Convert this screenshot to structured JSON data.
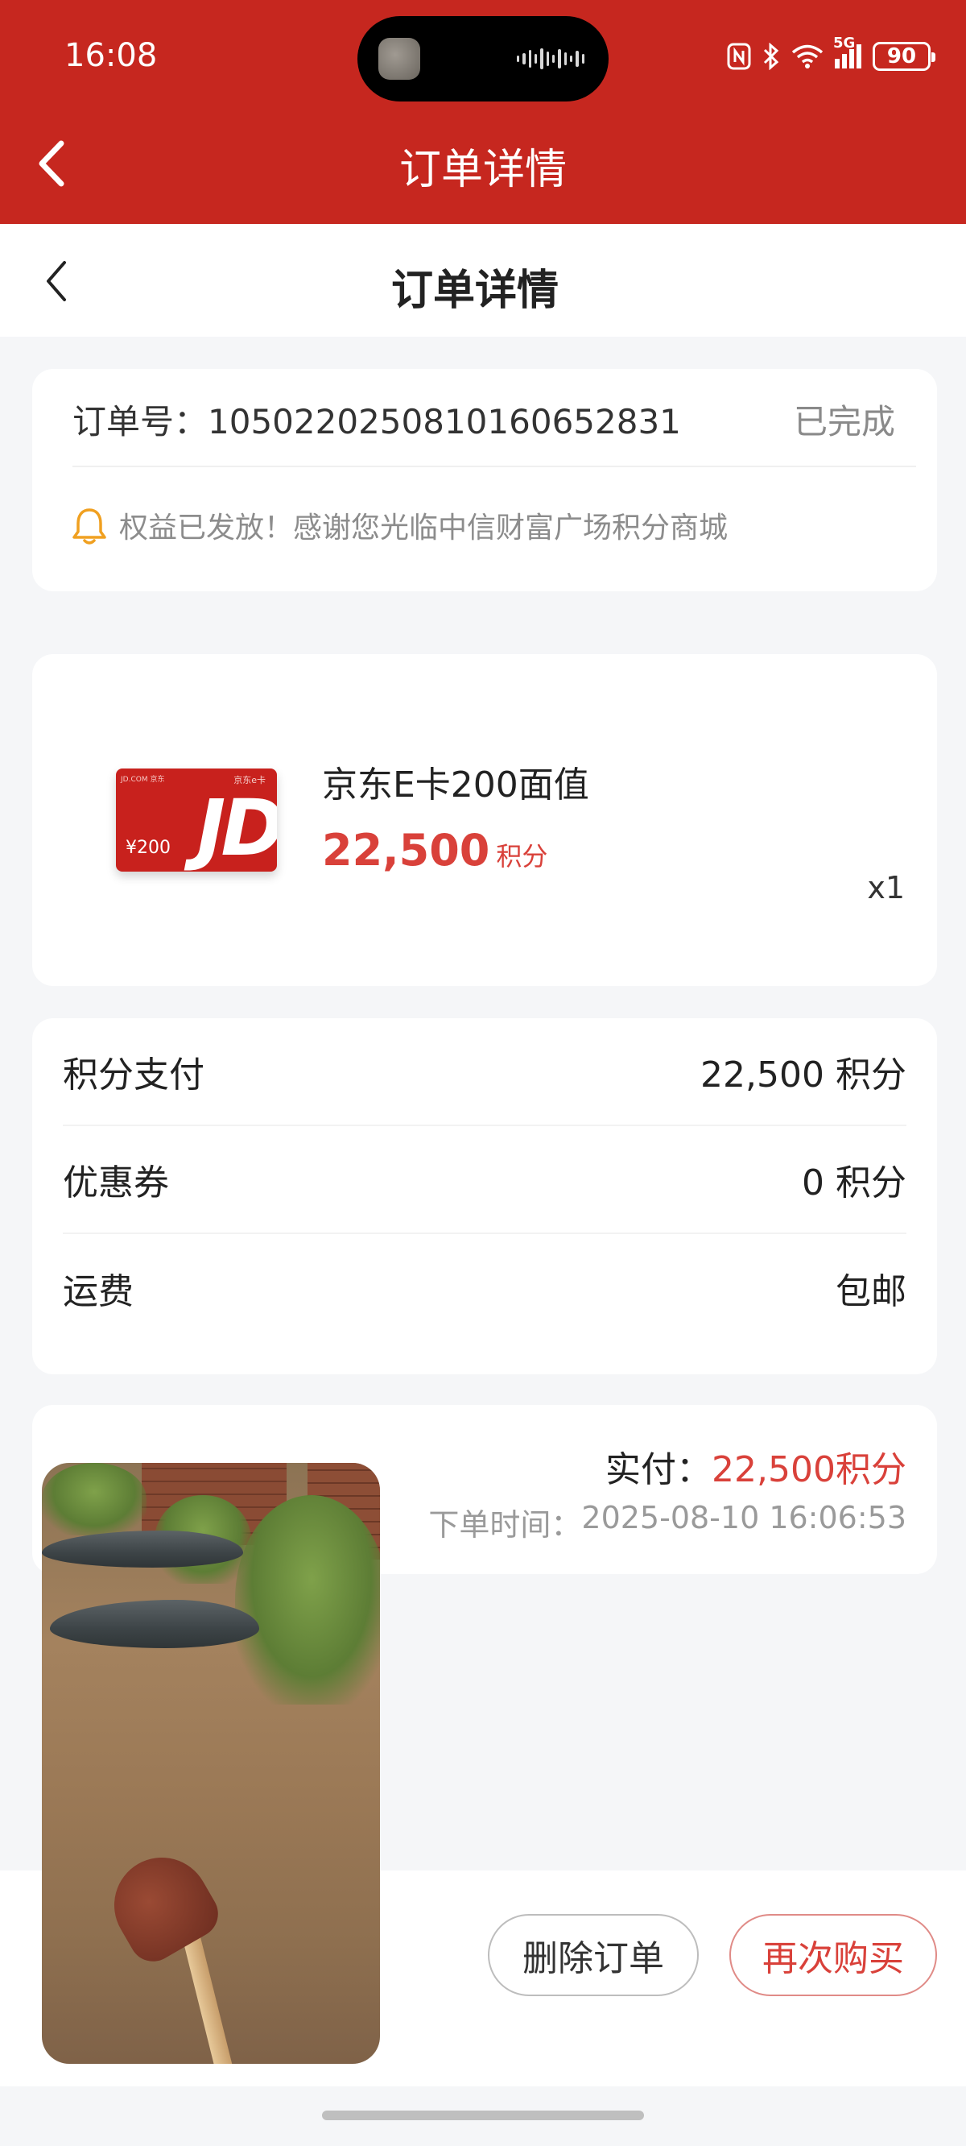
{
  "status_bar": {
    "time": "16:08",
    "icons": [
      "nfc-icon",
      "bluetooth-icon",
      "wifi-icon",
      "signal-5g-icon"
    ],
    "signal_label": "5G",
    "battery": "90"
  },
  "red_header": {
    "title": "订单详情"
  },
  "nav": {
    "title": "订单详情"
  },
  "order": {
    "number_label": "订单号：",
    "number": "105022025081016065​2831",
    "status": "已完成",
    "notice": "权益已发放！感谢您光临中信财富广场积分商城"
  },
  "product": {
    "name": "京东E卡200面值",
    "price": "22,500",
    "price_unit": "积分",
    "quantity": "x1",
    "card_image": {
      "brand_small": "JD.COM 京东",
      "brand_right": "京东e卡",
      "value": "¥200",
      "logo": "JD"
    }
  },
  "payment": {
    "rows": [
      {
        "label": "积分支付",
        "value": "22,500 积分"
      },
      {
        "label": "优惠券",
        "value": "0 积分"
      },
      {
        "label": "运费",
        "value": "包邮"
      }
    ]
  },
  "total": {
    "label": "实付：",
    "value": "22,500积分",
    "time_label": "下单时间：",
    "time": "2025-08-10 16:06:53"
  },
  "actions": {
    "delete": "删除订单",
    "rebuy": "再次购买"
  },
  "colors": {
    "brand_red": "#c6271f",
    "price_red": "#d9413a",
    "bell": "#f0a020"
  }
}
